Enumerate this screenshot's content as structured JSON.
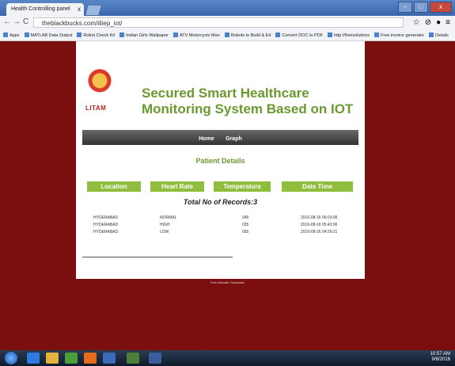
{
  "browser": {
    "tab_title": "Health Controlling panel",
    "tab_close": "x",
    "url": "theblackbucks.com/iiliep_iot/",
    "nav_back": "←",
    "nav_forward": "→",
    "nav_reload": "C",
    "tools": [
      "☆",
      "⊘",
      "●",
      "≡"
    ],
    "window_controls": [
      "–",
      "□",
      "x"
    ],
    "bookmarks": [
      "Apps",
      "MATLAB Data Output",
      "Robot Check Kit",
      "Indian Girls Wallpaper",
      "ATV Motorcycle Man",
      "Robots to Build & Ed",
      "Convert DOC to PDF",
      "http://freesolutions",
      "Free invoice generator",
      "Details"
    ]
  },
  "site": {
    "logo_text": "LITAM",
    "title": "Secured Smart Healthcare Monitoring System Based on IOT",
    "menu": [
      "Home",
      "Graph"
    ],
    "section_title": "Patient Details",
    "columns": [
      "Location",
      "Heart Rate",
      "Temperature",
      "Date Time"
    ],
    "records_label": "Total No of Records:3",
    "rows": [
      [
        "HYDERABAD",
        "NORMAL",
        "045",
        "2016-08-16 06:03:06"
      ],
      [
        "HYDERABAD",
        "HIGH",
        "035",
        "2016-08-16 05:43:06"
      ],
      [
        "HYDERABAD",
        "LOW",
        "055",
        "2016-08-26 04:29:21"
      ]
    ],
    "footer": "Free Website Templates"
  },
  "taskbar": {
    "time": "10:57 AM",
    "date": "9/8/2016"
  },
  "colors": {
    "background": "#7b0e0e",
    "accent_green": "#8fbe3e",
    "title_green": "#6a9a2f"
  }
}
